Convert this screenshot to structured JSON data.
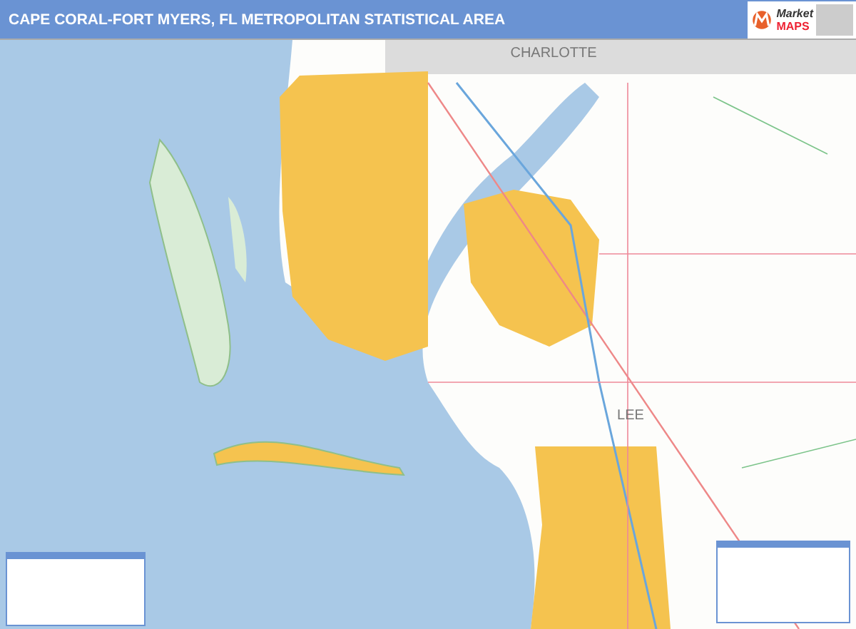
{
  "header": {
    "title": "CAPE CORAL-FORT MYERS, FL METROPOLITAN STATISTICAL AREA"
  },
  "logo": {
    "word": "Market",
    "name": "MAPS"
  },
  "map": {
    "labels": [
      {
        "text": "CHARLOTTE",
        "kind": "county-north"
      },
      {
        "text": "LEE",
        "kind": "county-center"
      }
    ]
  }
}
